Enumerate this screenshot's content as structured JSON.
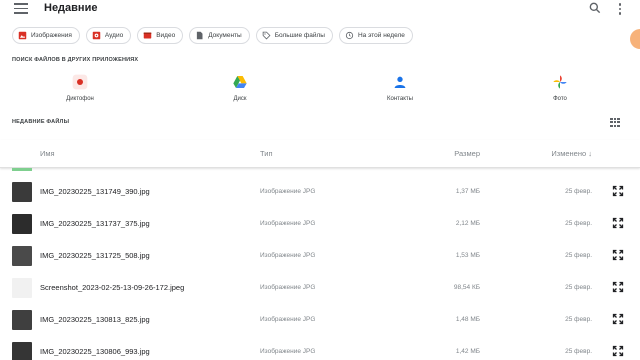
{
  "header": {
    "title": "Недавние",
    "menu_icon": "hamburger-menu-icon",
    "search_icon": "search-icon",
    "more_icon": "more-vert-icon"
  },
  "filters": [
    {
      "label": "Изображения",
      "icon": "image-icon",
      "color": "#d93025"
    },
    {
      "label": "Аудио",
      "icon": "audio-icon",
      "color": "#d93025"
    },
    {
      "label": "Видео",
      "icon": "video-icon",
      "color": "#d93025"
    },
    {
      "label": "Документы",
      "icon": "document-icon",
      "color": "#5f6368"
    },
    {
      "label": "Большие файлы",
      "icon": "tag-icon",
      "color": "#5f6368"
    },
    {
      "label": "На этой неделе",
      "icon": "history-icon",
      "color": "#5f6368"
    }
  ],
  "other_apps": {
    "label": "ПОИСК ФАЙЛОВ В ДРУГИХ ПРИЛОЖЕНИЯХ",
    "apps": [
      {
        "label": "Диктофон",
        "icon": "recorder-icon"
      },
      {
        "label": "Диск",
        "icon": "google-drive-icon"
      },
      {
        "label": "Контакты",
        "icon": "contacts-icon"
      },
      {
        "label": "Фото",
        "icon": "google-photos-icon"
      }
    ]
  },
  "recent": {
    "label": "НЕДАВНИЕ ФАЙЛЫ",
    "view_toggle_icon": "grid-view-icon",
    "columns": {
      "name": "Имя",
      "type": "Тип",
      "size": "Размер",
      "modified": "Изменено ↓"
    },
    "files": [
      {
        "name": "IMG_20230225_131749_390.jpg",
        "type": "Изображение JPG",
        "size": "1,37 МБ",
        "date": "25 февр.",
        "thumb": "#3a3a3a"
      },
      {
        "name": "IMG_20230225_131737_375.jpg",
        "type": "Изображение JPG",
        "size": "2,12 МБ",
        "date": "25 февр.",
        "thumb": "#2c2c2c"
      },
      {
        "name": "IMG_20230225_131725_508.jpg",
        "type": "Изображение JPG",
        "size": "1,53 МБ",
        "date": "25 февр.",
        "thumb": "#4a4a4a"
      },
      {
        "name": "Screenshot_2023-02-25-13-09-26-172.jpeg",
        "type": "Изображение JPG",
        "size": "98,54 КБ",
        "date": "25 февр.",
        "thumb": "#f1f1f1"
      },
      {
        "name": "IMG_20230225_130813_825.jpg",
        "type": "Изображение JPG",
        "size": "1,48 МБ",
        "date": "25 февр.",
        "thumb": "#3f3f3f"
      },
      {
        "name": "IMG_20230225_130806_993.jpg",
        "type": "Изображение JPG",
        "size": "1,42 МБ",
        "date": "25 февр.",
        "thumb": "#353535"
      }
    ]
  }
}
